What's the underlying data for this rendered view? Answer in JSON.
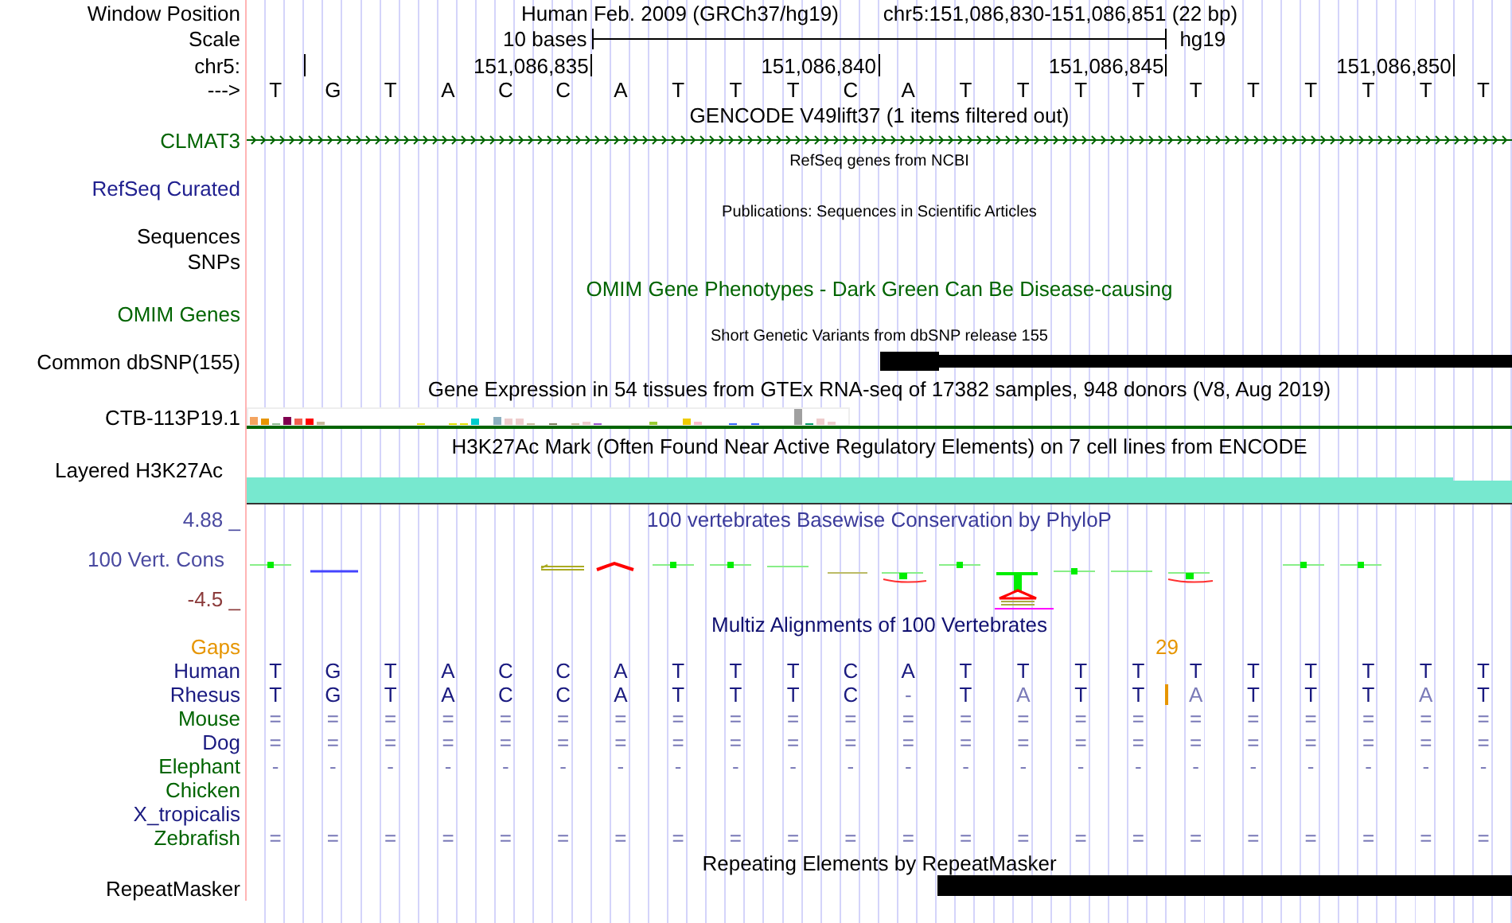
{
  "header": {
    "position_label": "Window Position",
    "assembly": "Human Feb. 2009 (GRCh37/hg19)",
    "range": "chr5:151,086,830-151,086,851 (22 bp)",
    "scale_label": "Scale",
    "scale_size": "10 bases",
    "scale_assembly": "hg19",
    "chrom_label": "chr5:",
    "ticks": [
      "151,086,835",
      "151,086,840",
      "151,086,845",
      "151,086,850"
    ],
    "strand_label": "--->",
    "bases": [
      "T",
      "G",
      "T",
      "A",
      "C",
      "C",
      "A",
      "T",
      "T",
      "T",
      "C",
      "A",
      "T",
      "T",
      "T",
      "T",
      "T",
      "T",
      "T",
      "T",
      "T",
      "T"
    ]
  },
  "tracks": [
    {
      "kind": "gene",
      "title": "GENCODE V49lift37 (1 items filtered out)",
      "label": "CLMAT3"
    },
    {
      "kind": "refseq",
      "title": "RefSeq genes from NCBI",
      "label": "RefSeq Curated"
    },
    {
      "kind": "publications",
      "title": "Publications: Sequences in Scientific Articles",
      "labels": [
        "Sequences",
        "SNPs"
      ]
    },
    {
      "kind": "omim",
      "title": "OMIM Gene Phenotypes - Dark Green Can Be Disease-causing",
      "label": "OMIM Genes"
    },
    {
      "kind": "variants",
      "title": "Short Genetic Variants from dbSNP release 155",
      "label": "Common dbSNP(155)"
    },
    {
      "kind": "expression",
      "title": "Gene Expression in 54 tissues from GTEx RNA-seq of 17382 samples, 948 donors (V8, Aug 2019)",
      "label": "CTB-113P19.1"
    },
    {
      "kind": "signal",
      "title": "H3K27Ac Mark (Often Found Near Active Regulatory Elements) on 7 cell lines from ENCODE",
      "label": "Layered H3K27Ac"
    },
    {
      "kind": "conservation",
      "title": "100 vertebrates Basewise Conservation by PhyloP",
      "label": "100 Vert. Cons",
      "max_label": "4.88 _",
      "min_label": "-4.5 _"
    },
    {
      "kind": "alignment",
      "title": "Multiz Alignments of 100 Vertebrates",
      "gaps": {
        "label": "Gaps",
        "count": "29"
      },
      "species": [
        {
          "name": "Human",
          "color": "#1a1a80",
          "bases": [
            "T",
            "G",
            "T",
            "A",
            "C",
            "C",
            "A",
            "T",
            "T",
            "T",
            "C",
            "A",
            "T",
            "T",
            "T",
            "T",
            "T",
            "T",
            "T",
            "T",
            "T",
            "T"
          ]
        },
        {
          "name": "Rhesus",
          "color": "#1a1a80",
          "bases": [
            "T",
            "G",
            "T",
            "A",
            "C",
            "C",
            "A",
            "T",
            "T",
            "T",
            "C",
            "-",
            "T",
            "A",
            "T",
            "T",
            "A",
            "T",
            "T",
            "T",
            "A",
            "T"
          ],
          "insert_before": [
            false,
            false,
            false,
            false,
            false,
            false,
            false,
            false,
            false,
            false,
            false,
            false,
            false,
            false,
            false,
            false,
            true,
            false,
            false,
            false,
            false,
            false
          ]
        },
        {
          "name": "Mouse",
          "color": "#006400",
          "bases": [
            "=",
            "=",
            "=",
            "=",
            "=",
            "=",
            "=",
            "=",
            "=",
            "=",
            "=",
            "=",
            "=",
            "=",
            "=",
            "=",
            "=",
            "=",
            "=",
            "=",
            "=",
            "="
          ]
        },
        {
          "name": "Dog",
          "color": "#1a1a80",
          "bases": [
            "=",
            "=",
            "=",
            "=",
            "=",
            "=",
            "=",
            "=",
            "=",
            "=",
            "=",
            "=",
            "=",
            "=",
            "=",
            "=",
            "=",
            "=",
            "=",
            "=",
            "=",
            "="
          ]
        },
        {
          "name": "Elephant",
          "color": "#006400",
          "bases": [
            "-",
            "-",
            "-",
            "-",
            "-",
            "-",
            "-",
            "-",
            "-",
            "-",
            "-",
            "-",
            "-",
            "-",
            "-",
            "-",
            "-",
            "-",
            "-",
            "-",
            "-",
            "-"
          ]
        },
        {
          "name": "Chicken",
          "color": "#006400"
        },
        {
          "name": "X_tropicalis",
          "color": "#1a1a80"
        },
        {
          "name": "Zebrafish",
          "color": "#006400",
          "bases": [
            "=",
            "=",
            "=",
            "=",
            "=",
            "=",
            "=",
            "=",
            "=",
            "=",
            "=",
            "=",
            "=",
            "=",
            "=",
            "=",
            "=",
            "=",
            "=",
            "=",
            "=",
            "="
          ]
        }
      ]
    },
    {
      "kind": "repeats",
      "title": "Repeating Elements by RepeatMasker",
      "label": "RepeatMasker"
    }
  ]
}
